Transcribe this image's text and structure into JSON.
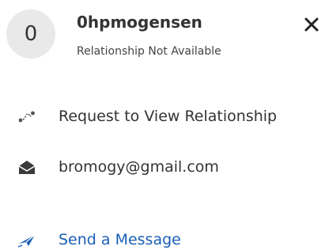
{
  "profile": {
    "avatar_initial": "0",
    "username": "0hpmogensen",
    "relationship_status": "Relationship Not Available"
  },
  "actions": {
    "request_relationship_label": "Request to View Relationship",
    "email": "bromogy@gmail.com",
    "send_message_label": "Send a Message"
  },
  "icons": {
    "close": "close-icon",
    "relationship": "relationship-icon",
    "email": "envelope-open-icon",
    "message": "paper-plane-icon"
  },
  "colors": {
    "text": "#333333",
    "link": "#1a5fb4",
    "avatar_bg": "#e9e9e9"
  }
}
